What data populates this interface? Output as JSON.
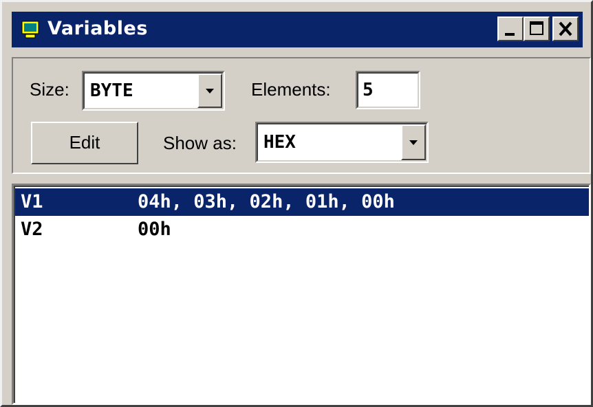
{
  "window": {
    "title": "Variables",
    "title_icon": "monitor-icon",
    "buttons": [
      "minimize-icon",
      "maximize-icon",
      "close-icon"
    ]
  },
  "controls": {
    "size_label": "Size:",
    "size_value": "BYTE",
    "elements_label": "Elements:",
    "elements_value": "5",
    "edit_label": "Edit",
    "show_as_label": "Show as:",
    "show_as_value": "HEX"
  },
  "variables": [
    {
      "name": "V1",
      "value": "04h, 03h, 02h, 01h, 00h",
      "selected": true
    },
    {
      "name": "V2",
      "value": "00h",
      "selected": false
    }
  ],
  "colors": {
    "titlebar": "#0a246a",
    "face": "#d4d0c8",
    "selection": "#0a246a"
  }
}
